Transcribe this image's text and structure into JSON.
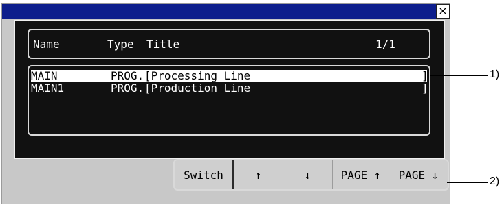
{
  "window": {
    "close_label": "×"
  },
  "header": {
    "col_name": "Name",
    "col_type": "Type",
    "col_title": "Title",
    "page_indicator": "1/1"
  },
  "programs": [
    {
      "name": "MAIN",
      "type": "PROG.",
      "title": "[Processing Line",
      "end": "]",
      "selected": true
    },
    {
      "name": "MAIN1",
      "type": "PROG.",
      "title": "[Production Line",
      "end": "]",
      "selected": false
    }
  ],
  "buttons": {
    "switch": "Switch",
    "up": "↑",
    "down": "↓",
    "page_up": "PAGE ↑",
    "page_down": "PAGE ↓"
  },
  "callouts": {
    "list": "1)",
    "buttons": "2)"
  }
}
